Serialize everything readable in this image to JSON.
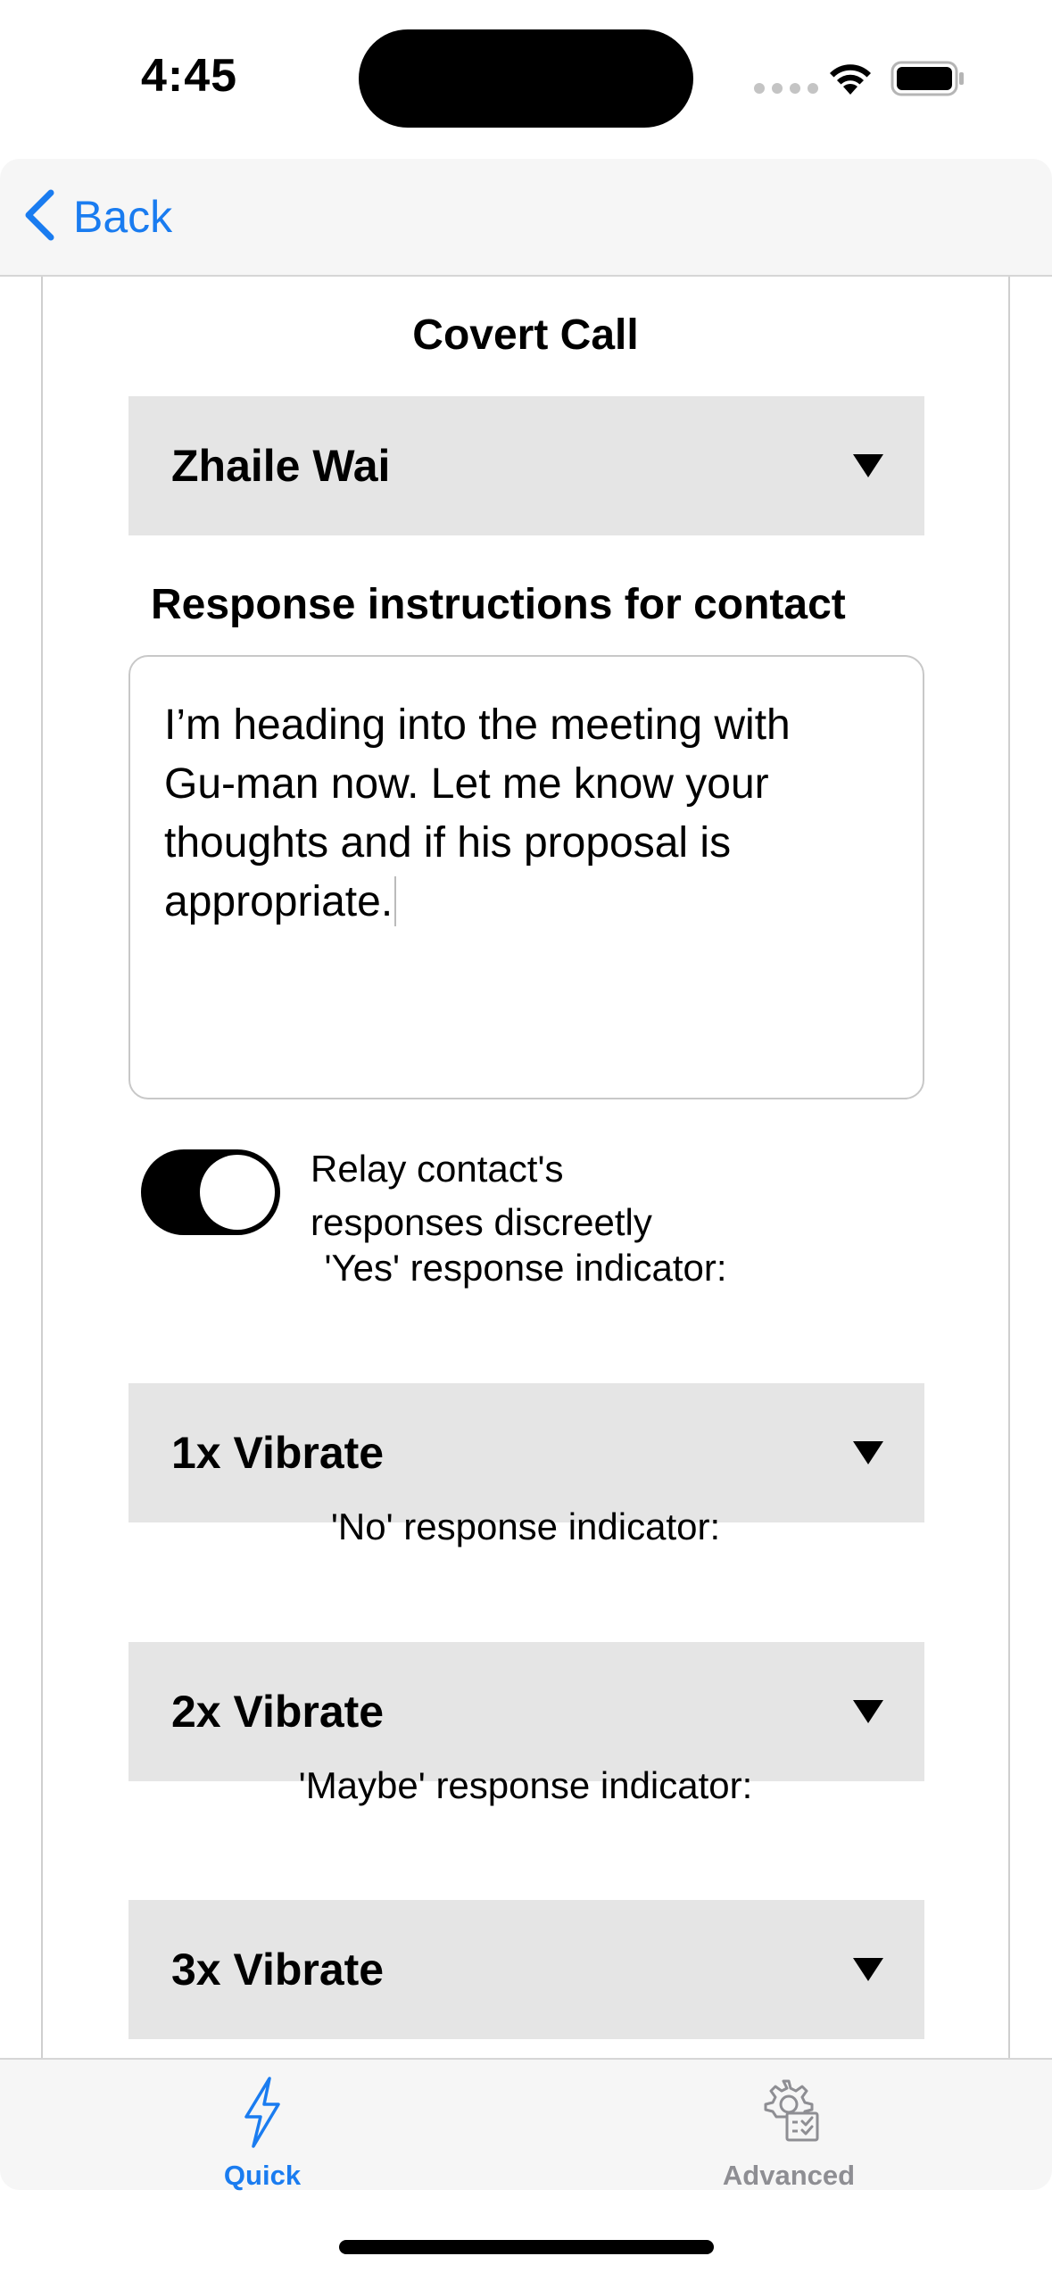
{
  "status_bar": {
    "time": "4:45",
    "icons": [
      "cellular-icon",
      "wifi-icon",
      "battery-icon"
    ]
  },
  "nav": {
    "back_label": "Back",
    "accent_color": "#1a7cf0"
  },
  "main": {
    "title": "Covert Call",
    "contact_dropdown": {
      "value": "Zhaile Wai"
    },
    "response_section_label": "Response instructions for contact",
    "instructions_lines": [
      "I’m heading into the meeting with",
      "Gu-man now. Let me know your",
      "thoughts and if his proposal is",
      "appropriate."
    ],
    "relay_toggle": {
      "label_line1": "Relay contact's",
      "label_line2": "responses discreetly",
      "on": true
    },
    "yes_indicator": {
      "label": "'Yes' response indicator:",
      "value": "1x Vibrate"
    },
    "no_indicator": {
      "label": "'No' response indicator:",
      "value": "2x Vibrate"
    },
    "maybe_indicator": {
      "label": "'Maybe' response indicator:",
      "value": "3x Vibrate"
    }
  },
  "tab_bar": {
    "tabs": [
      {
        "label": "Quick",
        "icon": "lightning-icon",
        "active": true,
        "color": "#1a7cf0"
      },
      {
        "label": "Advanced",
        "icon": "gear-checklist-icon",
        "active": false,
        "color": "#8e8e93"
      }
    ]
  }
}
